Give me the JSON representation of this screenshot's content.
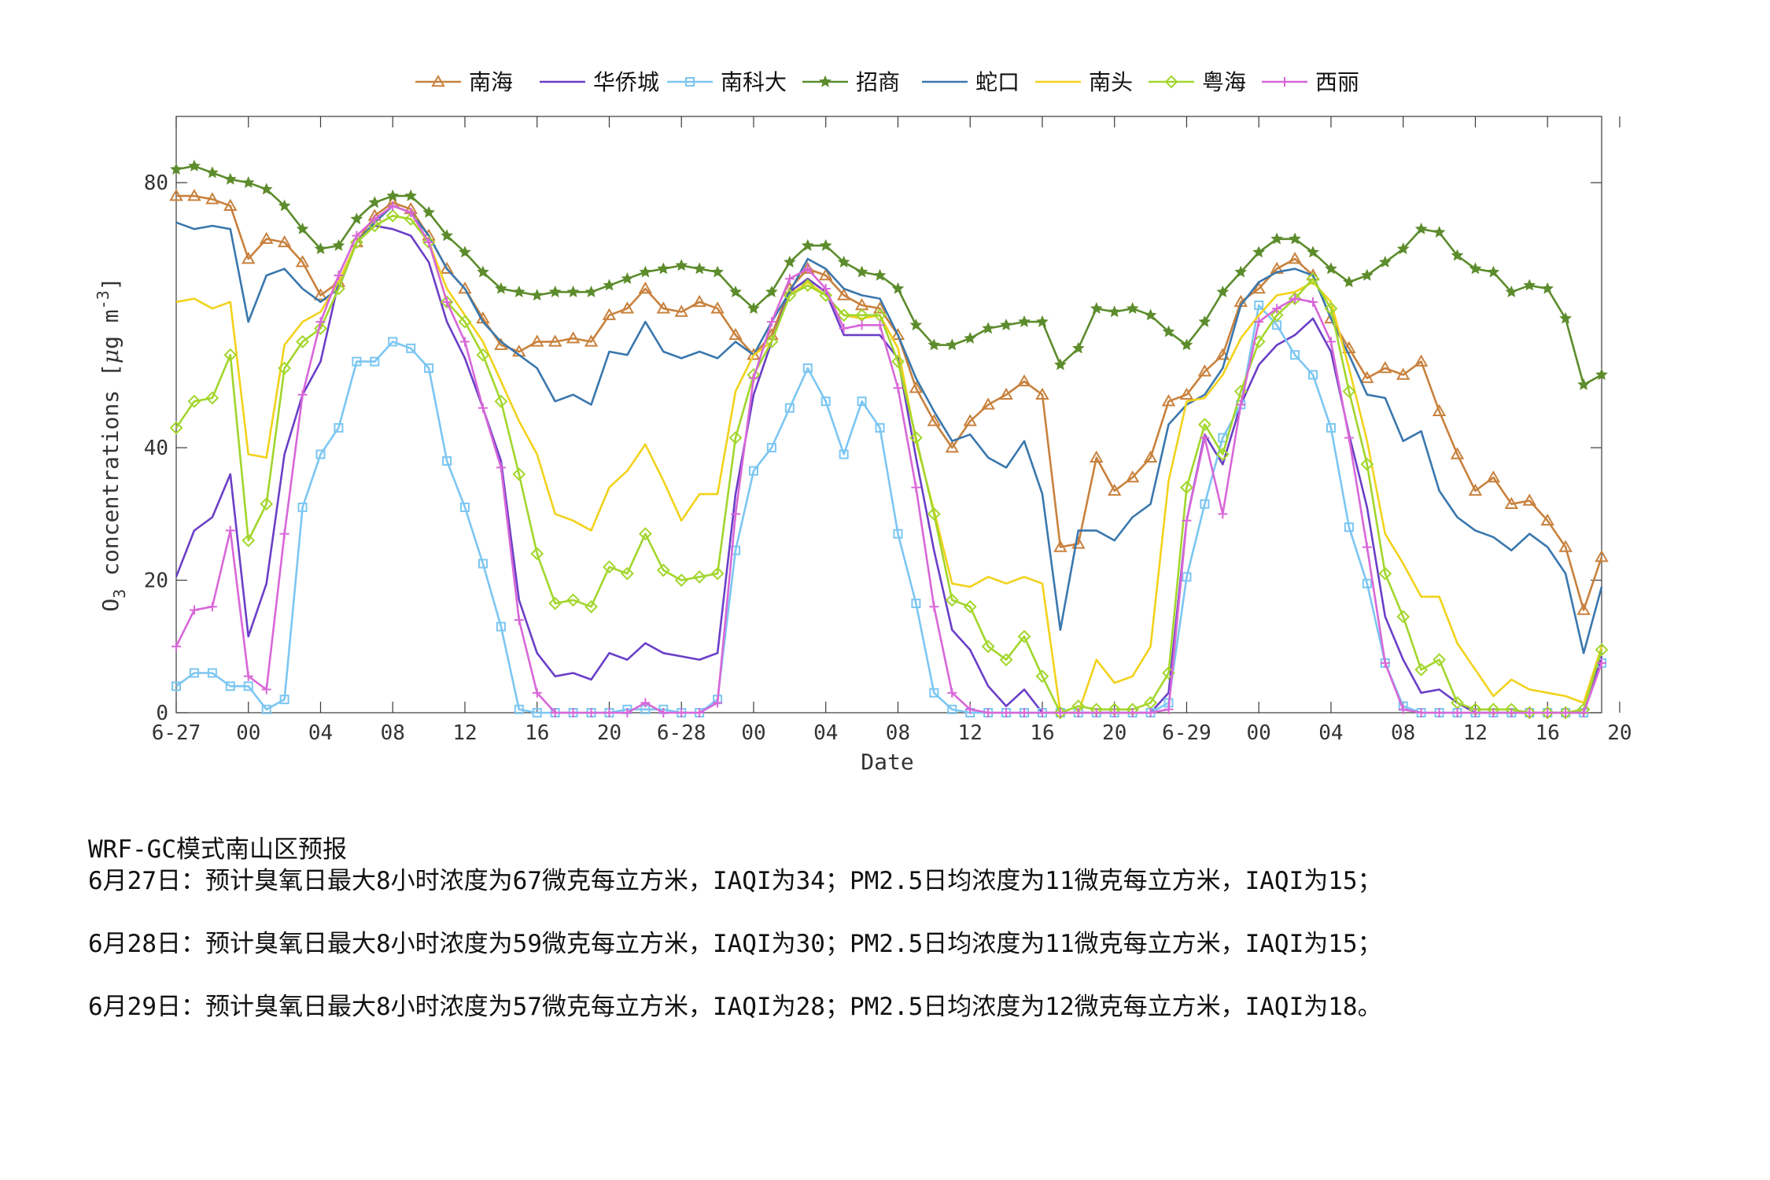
{
  "note": {
    "title": "WRF-GC模式南山区预报",
    "lines": [
      "6月27日：预计臭氧日最大8小时浓度为67微克每立方米，IAQI为34；PM2.5日均浓度为11微克每立方米，IAQI为15；",
      "6月28日：预计臭氧日最大8小时浓度为59微克每立方米，IAQI为30；PM2.5日均浓度为11微克每立方米，IAQI为15；",
      "6月29日：预计臭氧日最大8小时浓度为57微克每立方米，IAQI为28；PM2.5日均浓度为12微克每立方米，IAQI为18。"
    ]
  },
  "chart_data": {
    "type": "line",
    "xlabel": "Date",
    "ylabel_main": "O",
    "ylabel_sub": "3",
    "ylabel_rest": " concentrations [",
    "ylabel_mu": "μ",
    "ylabel_unit": "g m",
    "ylabel_sup": "-3",
    "ylabel_close": "]",
    "xlim": [
      0,
      79
    ],
    "ylim": [
      0,
      90
    ],
    "yticks": [
      0,
      20,
      40,
      80
    ],
    "xticks": [
      {
        "x": 0,
        "label": "6-27"
      },
      {
        "x": 4,
        "label": "00"
      },
      {
        "x": 8,
        "label": "04"
      },
      {
        "x": 12,
        "label": "08"
      },
      {
        "x": 16,
        "label": "12"
      },
      {
        "x": 20,
        "label": "16"
      },
      {
        "x": 24,
        "label": "20"
      },
      {
        "x": 28,
        "label": "6-28"
      },
      {
        "x": 32,
        "label": "00"
      },
      {
        "x": 36,
        "label": "04"
      },
      {
        "x": 40,
        "label": "08"
      },
      {
        "x": 44,
        "label": "12"
      },
      {
        "x": 48,
        "label": "16"
      },
      {
        "x": 52,
        "label": "20"
      },
      {
        "x": 56,
        "label": "6-29"
      },
      {
        "x": 60,
        "label": "00"
      },
      {
        "x": 64,
        "label": "04"
      },
      {
        "x": 68,
        "label": "08"
      },
      {
        "x": 72,
        "label": "12"
      },
      {
        "x": 76,
        "label": "16"
      },
      {
        "x": 80,
        "label": "20"
      }
    ],
    "grid": false,
    "legend_position": "top",
    "series": [
      {
        "name": "南海",
        "color": "#c8813d",
        "marker": "triangle",
        "values": [
          78,
          78,
          77.5,
          76.5,
          68.5,
          71.5,
          71,
          68,
          63,
          65,
          71,
          75,
          77,
          76,
          72,
          67,
          64,
          59.5,
          55.5,
          54.5,
          56,
          56,
          56.5,
          56,
          60,
          61,
          64,
          61,
          60.5,
          62,
          61,
          57,
          54,
          57,
          64,
          67,
          66,
          63,
          61.5,
          61,
          57,
          49,
          44,
          40,
          44,
          46.5,
          48,
          50,
          48,
          25,
          25.5,
          38.5,
          33.5,
          35.5,
          38.5,
          47,
          48,
          51.5,
          54,
          62,
          64,
          67,
          68.5,
          66,
          59.5,
          55,
          50.5,
          52,
          51,
          53,
          45.5,
          39,
          33.5,
          35.5,
          31.5,
          32,
          29,
          25,
          15.5,
          23.5
        ]
      },
      {
        "name": "华侨城",
        "color": "#6a3fc7",
        "values": [
          20.5,
          27.5,
          29.5,
          36,
          11.5,
          19.5,
          39,
          48,
          53,
          65,
          71,
          73.5,
          73,
          72,
          68,
          59,
          53.5,
          46,
          38,
          17,
          9,
          5.5,
          6,
          5,
          9,
          8,
          10.5,
          9,
          8.5,
          8,
          9,
          33,
          48,
          56,
          63.5,
          65.5,
          63.5,
          57,
          57,
          57,
          53.5,
          38.5,
          24.5,
          12.5,
          9.5,
          4,
          1,
          3.5,
          0,
          0,
          0,
          0,
          0,
          0,
          0,
          3,
          29,
          42,
          37.5,
          46.5,
          52.5,
          55.5,
          57,
          59.5,
          54.5,
          42,
          31,
          14.5,
          8,
          3,
          3.5,
          1.5,
          0,
          0,
          0,
          0,
          0,
          0,
          0,
          8.5
        ]
      },
      {
        "name": "南科大",
        "color": "#7cc6f2",
        "marker": "square",
        "values": [
          4,
          6,
          6,
          4,
          4,
          0.5,
          2,
          31,
          39,
          43,
          53,
          53,
          56,
          55,
          52,
          38,
          31,
          22.5,
          13,
          0.5,
          0,
          0,
          0,
          0,
          0,
          0.5,
          0.5,
          0.5,
          0,
          0,
          2,
          24.5,
          36.5,
          40,
          46,
          52,
          47,
          39,
          47,
          43,
          27,
          16.5,
          3,
          0.5,
          0,
          0,
          0,
          0,
          0,
          0,
          0,
          0,
          0,
          0,
          0,
          1.5,
          20.5,
          31.5,
          41.5,
          46.5,
          61.5,
          58.5,
          54,
          51,
          43,
          28,
          19.5,
          7.5,
          1,
          0,
          0,
          0,
          0,
          0,
          0,
          0,
          0,
          0,
          0,
          7.5
        ]
      },
      {
        "name": "招商",
        "color": "#5c8c2c",
        "marker": "star",
        "values": [
          82,
          82.5,
          81.5,
          80.5,
          80,
          79,
          76.5,
          73,
          70,
          70.5,
          74.5,
          77,
          78,
          78,
          75.5,
          72,
          69.5,
          66.5,
          64,
          63.5,
          63,
          63.5,
          63.5,
          63.5,
          64.5,
          65.5,
          66.5,
          67,
          67.5,
          67,
          66.5,
          63.5,
          61,
          63.5,
          68,
          70.5,
          70.5,
          68,
          66.5,
          66,
          64,
          58.5,
          55.5,
          55.5,
          56.5,
          58,
          58.5,
          59,
          59,
          52.5,
          55,
          61,
          60.5,
          61,
          60,
          57.5,
          55.5,
          59,
          63.5,
          66.5,
          69.5,
          71.5,
          71.5,
          69.5,
          67,
          65,
          66,
          68,
          70,
          73,
          72.5,
          69,
          67,
          66.5,
          63.5,
          64.5,
          64,
          59.5,
          49.5,
          51
        ]
      },
      {
        "name": "蛇口",
        "color": "#3a77ad",
        "values": [
          74,
          73,
          73.5,
          73,
          59,
          66,
          67,
          64,
          62,
          64,
          71,
          74,
          76.5,
          75.5,
          72,
          67,
          64,
          59,
          56,
          54,
          52,
          47,
          48,
          46.5,
          54.5,
          54,
          59,
          54.5,
          53.5,
          54.5,
          53.5,
          56,
          54,
          59,
          63.5,
          68.5,
          67,
          64,
          63,
          62.5,
          57,
          50.5,
          45.5,
          41,
          42,
          38.5,
          37,
          41,
          33,
          12.5,
          27.5,
          27.5,
          26,
          29.5,
          31.5,
          43.5,
          46.5,
          48,
          52,
          61.5,
          65,
          66.5,
          67,
          66,
          59.5,
          54,
          48,
          47.5,
          41,
          42.5,
          33.5,
          29.5,
          27.5,
          26.5,
          24.5,
          27,
          25,
          21,
          9,
          19
        ]
      },
      {
        "name": "南头",
        "color": "#f2d21c",
        "values": [
          62,
          62.5,
          61,
          62,
          39,
          38.5,
          55.5,
          59,
          60.5,
          65,
          71,
          73.5,
          75,
          74.5,
          71,
          64,
          60,
          56,
          50,
          44,
          39,
          30,
          29,
          27.5,
          34,
          36.5,
          40.5,
          35,
          29,
          33,
          33,
          48.5,
          54,
          56,
          63,
          65,
          63,
          60,
          59.5,
          60,
          55,
          41,
          30.5,
          19.5,
          19,
          20.5,
          19.5,
          20.5,
          19.5,
          0,
          0,
          8,
          4.5,
          5.5,
          10,
          35,
          47,
          47.5,
          51,
          56.5,
          60,
          63,
          63.5,
          65,
          62,
          52,
          41,
          27,
          22.5,
          17.5,
          17.5,
          10.5,
          6.5,
          2.5,
          5,
          3.5,
          3,
          2.5,
          1.5,
          10
        ]
      },
      {
        "name": "粤海",
        "color": "#a2d62c",
        "marker": "diamond",
        "values": [
          43,
          47,
          47.5,
          54,
          26,
          31.5,
          52,
          56,
          58,
          64,
          71,
          73.5,
          75,
          74.5,
          71,
          62,
          59,
          54,
          47,
          36,
          24,
          16.5,
          17,
          16,
          22,
          21,
          27,
          21.5,
          20,
          20.5,
          21,
          41.5,
          51,
          56,
          63,
          64.5,
          63,
          60,
          60,
          60,
          53,
          41.5,
          30,
          17,
          16,
          10,
          8,
          11.5,
          5.5,
          0,
          1,
          0.5,
          0.5,
          0.5,
          1.5,
          6,
          34,
          43.5,
          39,
          48.5,
          56,
          60,
          62.5,
          65.5,
          61,
          48.5,
          37.5,
          21,
          14.5,
          6.5,
          8,
          1.5,
          0.5,
          0.5,
          0.5,
          0,
          0,
          0,
          0.5,
          9.5
        ]
      },
      {
        "name": "西丽",
        "color": "#d867d8",
        "marker": "plus",
        "values": [
          10,
          15.5,
          16,
          27.5,
          5.5,
          3.5,
          27,
          48,
          59,
          66,
          72,
          74.5,
          76.5,
          75.5,
          71,
          62,
          56,
          46,
          37,
          14,
          3,
          0,
          0,
          0,
          0,
          0,
          1.5,
          0,
          0,
          0,
          1.5,
          30,
          50.5,
          59,
          65.5,
          67,
          64,
          58,
          58.5,
          58.5,
          49,
          34,
          16,
          3,
          0.5,
          0,
          0,
          0,
          0,
          0,
          0,
          0,
          0,
          0,
          0,
          0.5,
          29,
          41.5,
          30,
          46.5,
          59,
          61,
          62.5,
          62,
          56,
          41.5,
          25,
          7.5,
          0.5,
          0,
          0,
          0,
          0,
          0,
          0,
          0,
          0,
          0,
          0,
          7.5
        ]
      }
    ]
  }
}
